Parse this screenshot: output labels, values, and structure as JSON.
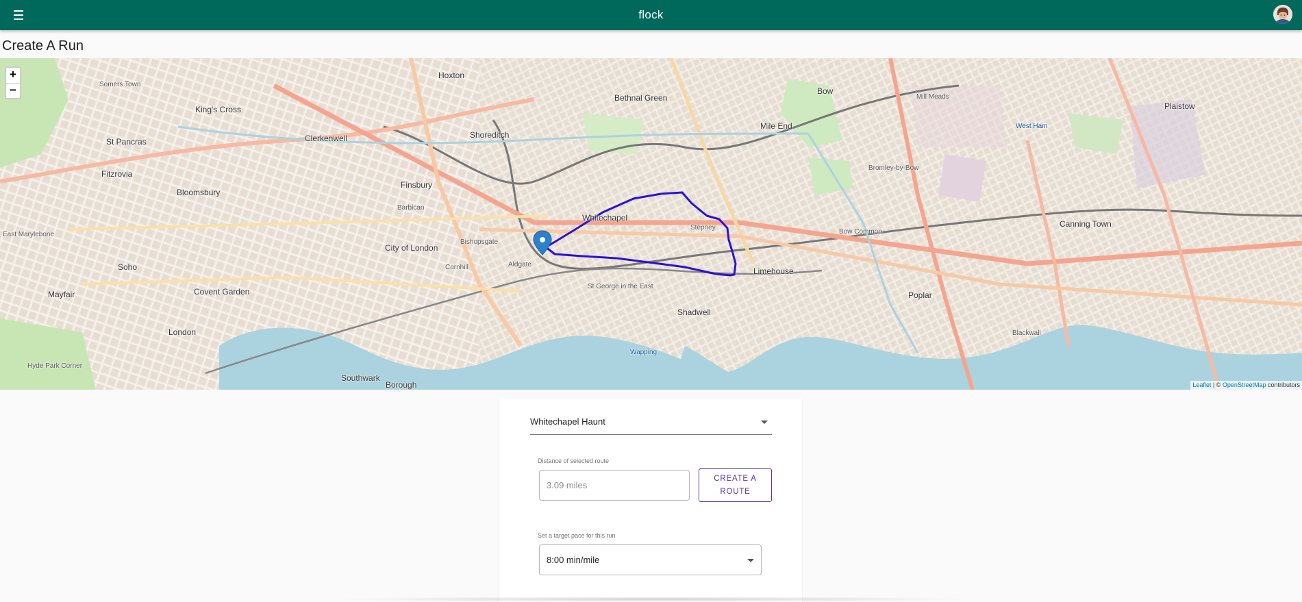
{
  "app": {
    "title": "flock",
    "menu_icon": "hamburger-menu-icon",
    "avatar_icon": "user-avatar"
  },
  "page": {
    "title": "Create A Run"
  },
  "map": {
    "zoom_in_label": "+",
    "zoom_out_label": "−",
    "attribution": {
      "leaflet": "Leaflet",
      "separator": " | © ",
      "osm": "OpenStreetMap",
      "suffix": " contributors"
    },
    "route_color": "#2a12d6",
    "marker_color": "#2a81cb",
    "labels": {
      "somers_town": "Somers Town",
      "kings_cross": "King's Cross",
      "st_pancras": "St Pancras",
      "clerkenwell": "Clerkenwell",
      "hoxton": "Hoxton",
      "shoreditch": "Shoreditch",
      "bethnal_green": "Bethnal Green",
      "mile_end": "Mile End",
      "bow": "Bow",
      "mill_meads": "Mill Meads",
      "plaistow": "Plaistow",
      "west_ham": "West Ham",
      "fitzrovia": "Fitzrovia",
      "bloomsbury": "Bloomsbury",
      "finsbury": "Finsbury",
      "barbican": "Barbican",
      "whitechapel": "Whitechapel",
      "stepney": "Stepney",
      "bromley_by_bow": "Bromley-by-Bow",
      "canning_town": "Canning Town",
      "marylebone": "East Marylebone",
      "city_of_london": "City of London",
      "bishopsgate": "Bishopsgate",
      "aldgate": "Aldgate",
      "bow_common": "Bow Common",
      "limehouse": "Limehouse",
      "soho": "Soho",
      "covent_garden": "Covent Garden",
      "mayfair": "Mayfair",
      "cornhill": "Cornhill",
      "st_george": "St George in the East",
      "poplar": "Poplar",
      "london": "London",
      "shadwell": "Shadwell",
      "wapping": "Wapping",
      "southwark": "Southwark",
      "borough": "Borough",
      "blackwall": "Blackwall",
      "hyde_park_corner": "Hyde Park Corner"
    }
  },
  "form": {
    "route_select_value": "Whitechapel Haunt",
    "distance_label": "Distance of selected route",
    "distance_value": "3.09 miles",
    "create_route_label": "CREATE A ROUTE",
    "pace_label": "Set a target pace for this run",
    "pace_value": "8:00 min/mile"
  }
}
